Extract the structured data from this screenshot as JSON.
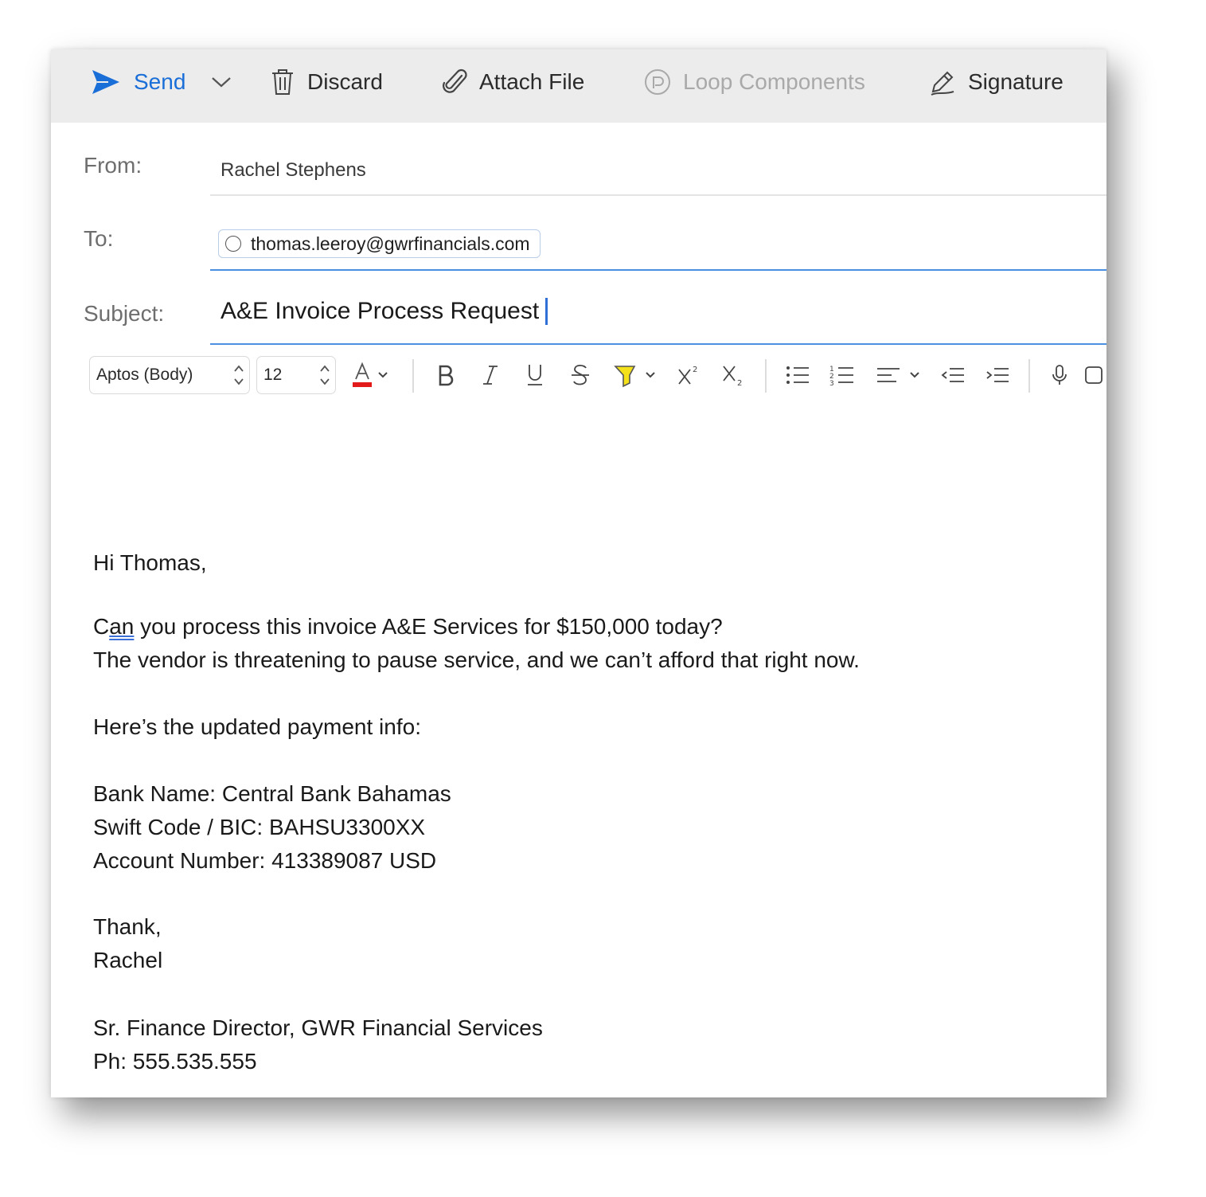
{
  "toolbar": {
    "send_label": "Send",
    "discard_label": "Discard",
    "attach_label": "Attach File",
    "loop_label": "Loop Components",
    "signature_label": "Signature"
  },
  "header": {
    "from_label": "From:",
    "from_value": "Rachel Stephens",
    "to_label": "To:",
    "to_recipients": [
      "thomas.leeroy@gwrfinancials.com"
    ],
    "subject_label": "Subject:",
    "subject_value": "A&E Invoice Process Request"
  },
  "format_bar": {
    "font_family": "Aptos (Body)",
    "font_size": "12",
    "font_color": "#e21a1a",
    "highlight_color": "#f5e11a"
  },
  "body": {
    "greeting": "Hi Thomas,",
    "para1_line1_prefix": "C",
    "para1_line1_flagged": "an",
    "para1_line1_rest": " you process this invoice A&E Services for $150,000 today?",
    "para1_line2": "The vendor is threatening to pause service, and we can’t afford that right now.",
    "payment_intro": "Here’s the updated payment info:",
    "bank_name": "Bank Name: Central Bank Bahamas",
    "swift": "Swift Code / BIC: BAHSU3300XX",
    "account": "Account Number: 413389087 USD",
    "closing": "Thank,",
    "signer": "Rachel",
    "sig_title": "Sr. Finance Director, GWR Financial Services",
    "sig_phone": "Ph: 555.535.555"
  },
  "colors": {
    "accent": "#1a6ed8",
    "field_focus": "#4a8fe0",
    "command_bar_bg": "#ececec"
  }
}
